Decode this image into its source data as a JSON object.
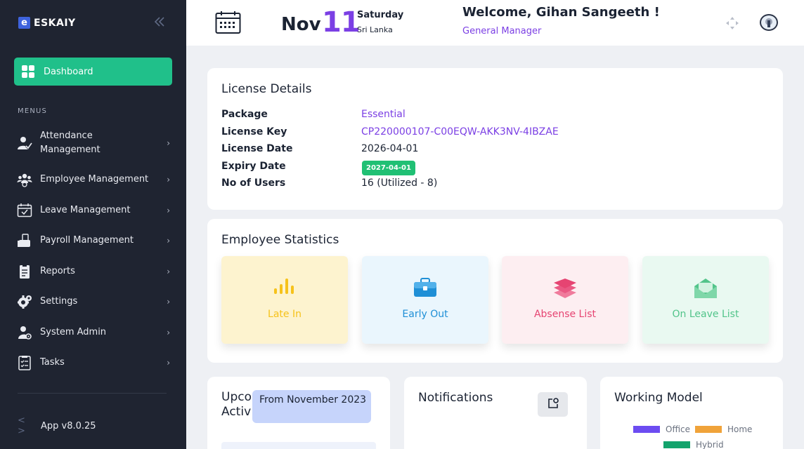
{
  "brand": {
    "logo_letter": "e",
    "name": "ESKAIY"
  },
  "sidebar": {
    "collapse_icon": "double-chevron-left-icon",
    "dashboard_label": "Dashboard",
    "menus_label": "MENUS",
    "items": [
      {
        "label": "Attendance\nManagement",
        "icon": "attendance-icon"
      },
      {
        "label": "Employee Management",
        "icon": "employee-icon"
      },
      {
        "label": "Leave Management",
        "icon": "leave-calendar-icon"
      },
      {
        "label": "Payroll Management",
        "icon": "payroll-icon"
      },
      {
        "label": "Reports",
        "icon": "reports-icon"
      },
      {
        "label": "Settings",
        "icon": "settings-gear-icon"
      },
      {
        "label": "System Admin",
        "icon": "system-admin-icon"
      },
      {
        "label": "Tasks",
        "icon": "tasks-icon"
      }
    ],
    "app_version": "App v8.0.25"
  },
  "header": {
    "month": "Nov",
    "day": "11",
    "weekday": "Saturday",
    "country": "Sri Lanka",
    "welcome": "Welcome, Gihan Sangeeth !",
    "role": "General Manager"
  },
  "license": {
    "title": "License Details",
    "rows": [
      {
        "key": "Package",
        "value": "Essential"
      },
      {
        "key": "License Key",
        "value": "CP220000107-C00EQW-AKK3NV-4IBZAE"
      },
      {
        "key": "License Date",
        "value": "2026-04-01"
      },
      {
        "key": "Expiry Date",
        "value": "2027-04-01"
      },
      {
        "key": "No of Users",
        "value": "16 (Utilized - 8)"
      }
    ]
  },
  "stats": {
    "title": "Employee Statistics",
    "tiles": [
      {
        "label": "Late In",
        "bg": "#fdf3cf",
        "color": "#f6c21b",
        "icon": "bar-chart-icon"
      },
      {
        "label": "Early Out",
        "bg": "#eaf6fd",
        "color": "#1f8fd6",
        "icon": "briefcase-icon"
      },
      {
        "label": "Absense List",
        "bg": "#fdeef1",
        "color": "#e64472",
        "icon": "layers-icon"
      },
      {
        "label": "On Leave List",
        "bg": "#e9f9f1",
        "color": "#52c48a",
        "icon": "envelope-open-icon"
      }
    ]
  },
  "upcoming": {
    "title_line1": "Upco",
    "title_line2": "Activ",
    "from_label": "From November 2023"
  },
  "notifications": {
    "title": "Notifications",
    "button_icon": "external-link-icon"
  },
  "working_model": {
    "title": "Working Model",
    "legend": [
      {
        "label": "Office",
        "color": "#6c4cf1"
      },
      {
        "label": "Home",
        "color": "#f0a33a"
      },
      {
        "label": "Hybrid",
        "color": "#13a36c"
      }
    ]
  }
}
